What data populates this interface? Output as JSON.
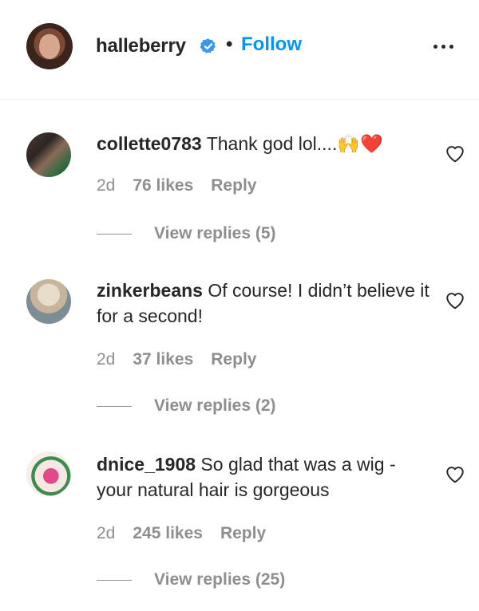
{
  "post": {
    "username": "halleberry",
    "separator": "•",
    "follow_label": "Follow"
  },
  "comments": [
    {
      "username": "collette0783",
      "text": "Thank god lol....🙌❤️",
      "time": "2d",
      "likes": "76 likes",
      "reply_label": "Reply",
      "view_replies": "View replies (5)"
    },
    {
      "username": "zinkerbeans",
      "text": "Of course! I didn’t believe it for a second!",
      "time": "2d",
      "likes": "37 likes",
      "reply_label": "Reply",
      "view_replies": "View replies (2)"
    },
    {
      "username": "dnice_1908",
      "text": "So glad that was a wig - your natural hair is gorgeous",
      "time": "2d",
      "likes": "245 likes",
      "reply_label": "Reply",
      "view_replies": "View replies (25)"
    }
  ],
  "colors": {
    "follow": "#0095f6",
    "verified": "#3897f0",
    "muted": "#8e8e8e",
    "text": "#262626"
  },
  "icons": [
    "verified-badge-icon",
    "more-options-icon",
    "heart-icon"
  ]
}
